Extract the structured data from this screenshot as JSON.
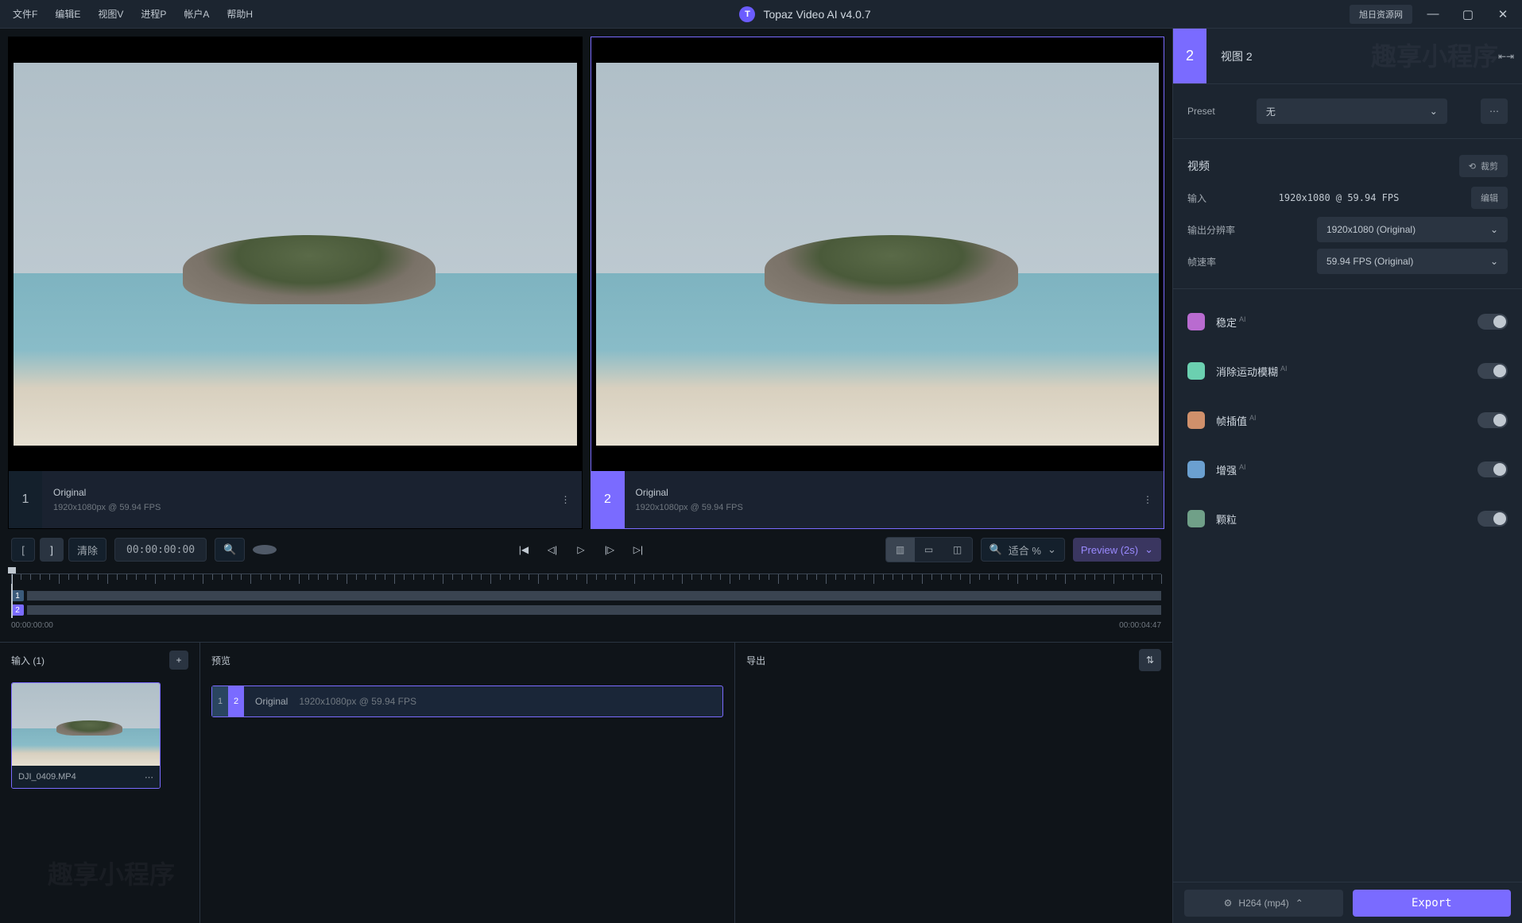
{
  "app": {
    "title": "Topaz Video AI  v4.0.7",
    "tag": "旭日资源网"
  },
  "menu": [
    "文件F",
    "编辑E",
    "视图V",
    "进程P",
    "帐户A",
    "帮助H"
  ],
  "preview": {
    "panes": [
      {
        "num": "1",
        "name": "Original",
        "meta": "1920x1080px @ 59.94 FPS",
        "selected": false
      },
      {
        "num": "2",
        "name": "Original",
        "meta": "1920x1080px @ 59.94 FPS",
        "selected": true
      }
    ]
  },
  "toolbar": {
    "mark_in": "[",
    "mark_out": "]",
    "clear": "清除",
    "timecode": "00:00:00:00",
    "zoom_mode": "适合 %",
    "preview_label": "Preview (2s)"
  },
  "timeline": {
    "start": "00:00:00:00",
    "end": "00:00:04:47"
  },
  "panels": {
    "input": {
      "title": "输入 (1)",
      "file": "DJI_0409.MP4"
    },
    "preview": {
      "title": "预览",
      "row_name": "Original",
      "row_meta": "1920x1080px @ 59.94 FPS"
    },
    "export": {
      "title": "导出"
    }
  },
  "side": {
    "num": "2",
    "title": "视图 2",
    "preset": {
      "label": "Preset",
      "value": "无"
    },
    "video": {
      "title": "视频",
      "crop": "裁剪",
      "input_label": "输入",
      "input_value": "1920x1080 @ 59.94 FPS",
      "edit": "编辑",
      "out_label": "输出分辨率",
      "out_value": "1920x1080 (Original)",
      "fps_label": "帧速率",
      "fps_value": "59.94 FPS (Original)"
    },
    "enhancers": [
      {
        "name": "稳定",
        "ai": true,
        "color": "#b96bd0"
      },
      {
        "name": "消除运动模糊",
        "ai": true,
        "color": "#6bd0b0"
      },
      {
        "name": "帧插值",
        "ai": true,
        "color": "#d0906b"
      },
      {
        "name": "增强",
        "ai": true,
        "color": "#6ba0d0"
      },
      {
        "name": "颗粒",
        "ai": false,
        "color": "#70a088"
      }
    ],
    "footer": {
      "codec": "H264 (mp4)",
      "export": "Export"
    }
  }
}
